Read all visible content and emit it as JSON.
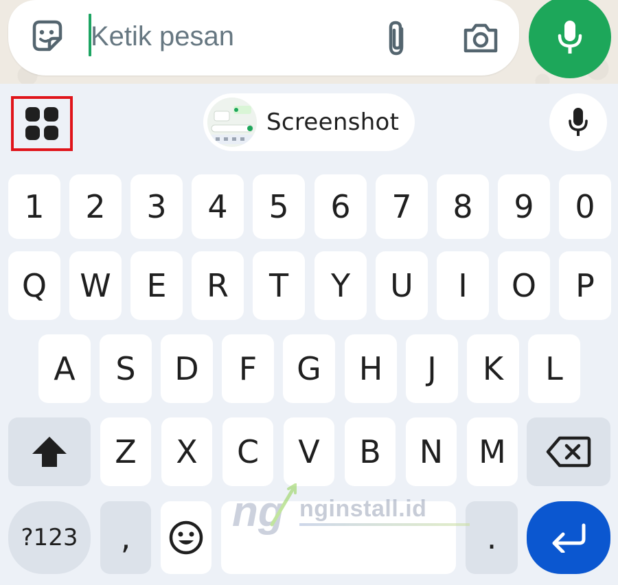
{
  "chat_input": {
    "placeholder": "Ketik pesan",
    "value": "",
    "icons": {
      "sticker": "sticker-icon",
      "attach": "paperclip-icon",
      "camera": "camera-icon",
      "voice": "microphone-icon"
    },
    "accent_color": "#1da75a"
  },
  "suggestion_bar": {
    "apps_icon": "grid-apps-icon",
    "clipboard_chip_label": "Screenshot",
    "mic_icon": "microphone-icon",
    "highlight_color": "#e0141a"
  },
  "keyboard": {
    "number_row": [
      "1",
      "2",
      "3",
      "4",
      "5",
      "6",
      "7",
      "8",
      "9",
      "0"
    ],
    "row1": [
      "Q",
      "W",
      "E",
      "R",
      "T",
      "Y",
      "U",
      "I",
      "O",
      "P"
    ],
    "row2": [
      "A",
      "S",
      "D",
      "F",
      "G",
      "H",
      "J",
      "K",
      "L"
    ],
    "row3": [
      "Z",
      "X",
      "C",
      "V",
      "B",
      "N",
      "M"
    ],
    "symbols_label": "?123",
    "comma_label": ",",
    "period_label": ".",
    "shift_icon": "shift-arrow-icon",
    "backspace_icon": "backspace-icon",
    "emoji_icon": "smiley-icon",
    "enter_icon": "enter-arrow-icon",
    "enter_color": "#0b57d0"
  },
  "watermark": {
    "logo_letters": "ng",
    "text": "nginstall.id"
  }
}
